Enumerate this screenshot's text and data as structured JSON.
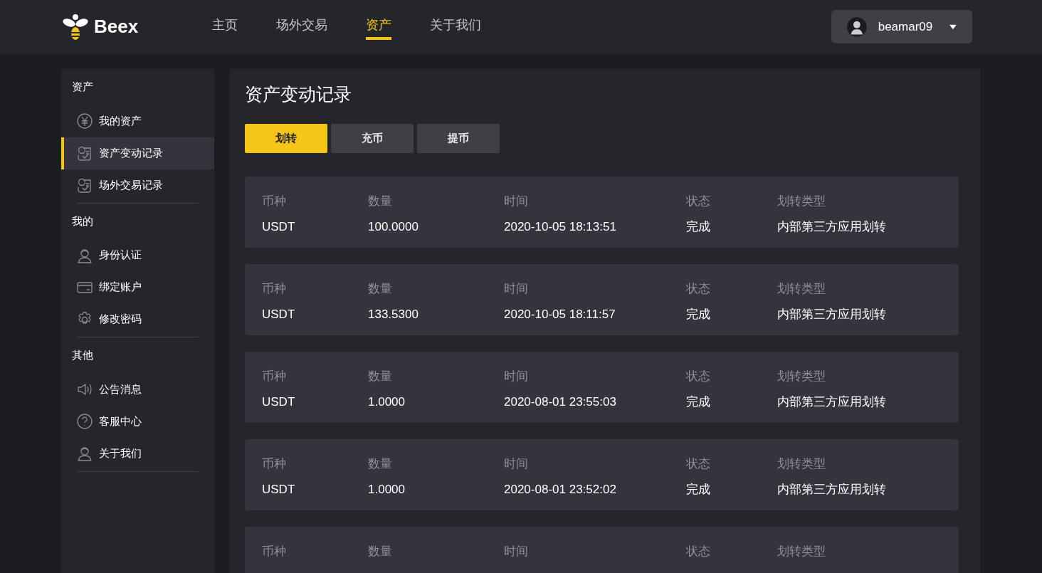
{
  "brand": {
    "name": "Beex"
  },
  "nav": [
    {
      "label": "主页",
      "selected": false
    },
    {
      "label": "场外交易",
      "selected": false
    },
    {
      "label": "资产",
      "selected": true
    },
    {
      "label": "关于我们",
      "selected": false
    }
  ],
  "user": {
    "name": "beamar09"
  },
  "sidebar": [
    {
      "heading": "资产",
      "items": [
        {
          "label": "我的资产",
          "kind": "yen",
          "selected": false
        },
        {
          "label": "资产变动记录",
          "kind": "receipt",
          "selected": true
        },
        {
          "label": "场外交易记录",
          "kind": "receipt",
          "selected": false
        }
      ]
    },
    {
      "heading": "我的",
      "items": [
        {
          "label": "身份认证",
          "kind": "person",
          "selected": false
        },
        {
          "label": "绑定账户",
          "kind": "card",
          "selected": false
        },
        {
          "label": "修改密码",
          "kind": "gear",
          "selected": false
        }
      ]
    },
    {
      "heading": "其他",
      "items": [
        {
          "label": "公告消息",
          "kind": "speaker",
          "selected": false
        },
        {
          "label": "客服中心",
          "kind": "question",
          "selected": false
        },
        {
          "label": "关于我们",
          "kind": "person",
          "selected": false
        }
      ]
    }
  ],
  "page_title": "资产变动记录",
  "tabs": [
    {
      "label": "划转",
      "selected": true
    },
    {
      "label": "充币",
      "selected": false
    },
    {
      "label": "提币",
      "selected": false
    }
  ],
  "records": [
    {
      "fields": [
        {
          "label": "币种",
          "value": "USDT"
        },
        {
          "label": "数量",
          "value": "100.0000"
        },
        {
          "label": "时间",
          "value": "2020-10-05 18:13:51"
        },
        {
          "label": "状态",
          "value": "完成"
        },
        {
          "label": "划转类型",
          "value": "内部第三方应用划转"
        }
      ]
    },
    {
      "fields": [
        {
          "label": "币种",
          "value": "USDT"
        },
        {
          "label": "数量",
          "value": "133.5300"
        },
        {
          "label": "时间",
          "value": "2020-10-05 18:11:57"
        },
        {
          "label": "状态",
          "value": "完成"
        },
        {
          "label": "划转类型",
          "value": "内部第三方应用划转"
        }
      ]
    },
    {
      "fields": [
        {
          "label": "币种",
          "value": "USDT"
        },
        {
          "label": "数量",
          "value": "1.0000"
        },
        {
          "label": "时间",
          "value": "2020-08-01 23:55:03"
        },
        {
          "label": "状态",
          "value": "完成"
        },
        {
          "label": "划转类型",
          "value": "内部第三方应用划转"
        }
      ]
    },
    {
      "fields": [
        {
          "label": "币种",
          "value": "USDT"
        },
        {
          "label": "数量",
          "value": "1.0000"
        },
        {
          "label": "时间",
          "value": "2020-08-01 23:52:02"
        },
        {
          "label": "状态",
          "value": "完成"
        },
        {
          "label": "划转类型",
          "value": "内部第三方应用划转"
        }
      ]
    },
    {
      "fields": [
        {
          "label": "币种"
        },
        {
          "label": "数量"
        },
        {
          "label": "时间"
        },
        {
          "label": "状态"
        },
        {
          "label": "划转类型"
        }
      ]
    }
  ]
}
